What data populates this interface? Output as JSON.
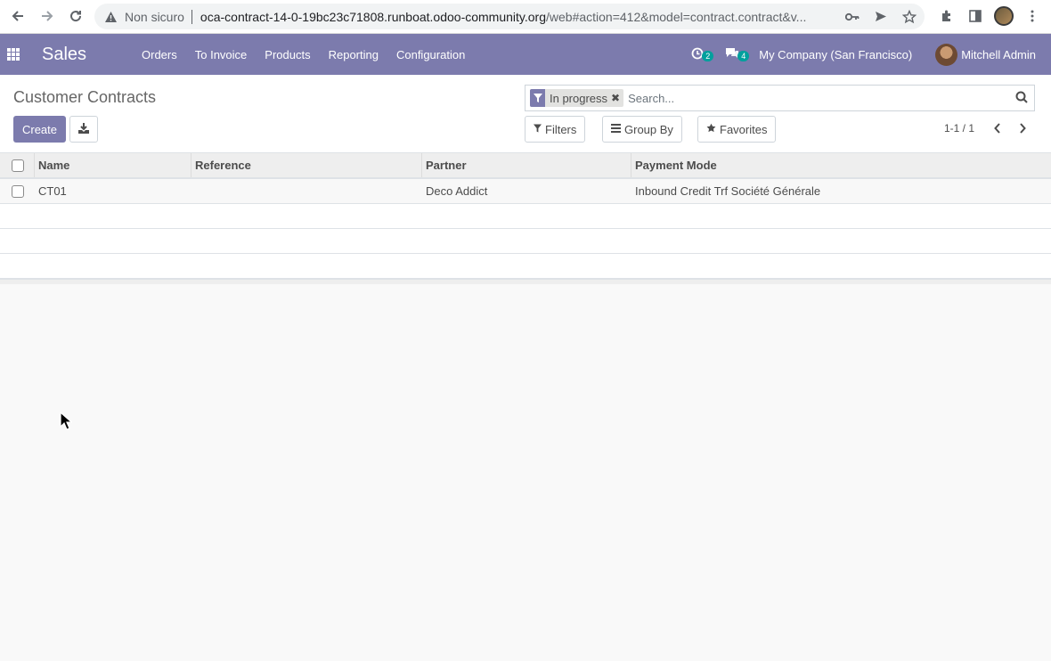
{
  "browser": {
    "insecure_label": "Non sicuro",
    "url_host": "oca-contract-14-0-19bc23c71808.runboat.odoo-community.org",
    "url_rest": "/web#action=412&model=contract.contract&v..."
  },
  "navbar": {
    "brand": "Sales",
    "menu": [
      "Orders",
      "To Invoice",
      "Products",
      "Reporting",
      "Configuration"
    ],
    "activity_count": "2",
    "message_count": "4",
    "company": "My Company (San Francisco)",
    "user": "Mitchell Admin",
    "color": "#7c7bad"
  },
  "control_panel": {
    "title": "Customer Contracts",
    "create_label": "Create",
    "facet": "In progress",
    "search_placeholder": "Search...",
    "filters_label": "Filters",
    "groupby_label": "Group By",
    "favorites_label": "Favorites",
    "pager": "1-1 / 1"
  },
  "list": {
    "columns": [
      "Name",
      "Reference",
      "Partner",
      "Payment Mode"
    ],
    "rows": [
      {
        "name": "CT01",
        "reference": "",
        "partner": "Deco Addict",
        "payment_mode": "Inbound Credit Trf Société Générale"
      }
    ]
  }
}
